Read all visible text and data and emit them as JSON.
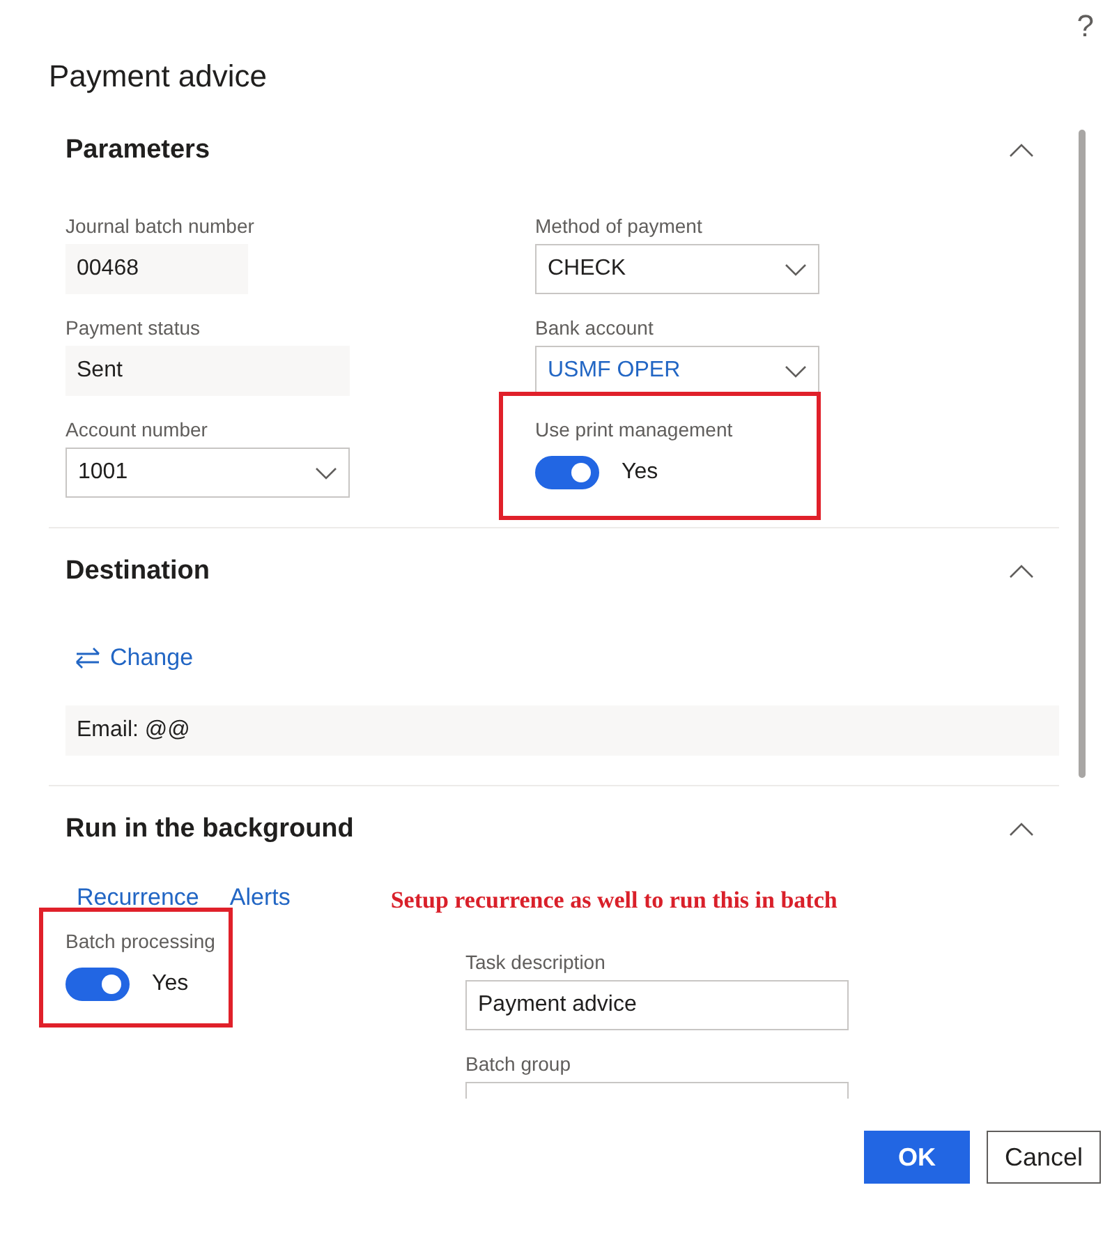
{
  "help": "?",
  "title": "Payment advice",
  "parameters": {
    "title": "Parameters",
    "expanded": true,
    "left_fields": [
      {
        "kind": "readonly",
        "label": "Journal batch number",
        "value": "00468"
      },
      {
        "kind": "readonly",
        "label": "Payment status",
        "value": "Sent"
      },
      {
        "kind": "dropdown",
        "label": "Account number",
        "value": "1001",
        "link": false
      }
    ],
    "right_fields": [
      {
        "kind": "dropdown",
        "label": "Method of payment",
        "value": "CHECK",
        "link": false
      },
      {
        "kind": "dropdown",
        "label": "Bank account",
        "value": "USMF OPER",
        "link": true
      },
      {
        "kind": "toggle",
        "label": "Use print management",
        "on": true,
        "value": "Yes",
        "highlighted": true
      }
    ]
  },
  "destination": {
    "title": "Destination",
    "expanded": true,
    "change_link": "Change",
    "email": "Email: @@"
  },
  "background": {
    "title": "Run in the background",
    "expanded": true,
    "tabs": [
      {
        "label": "Recurrence",
        "selected": false
      },
      {
        "label": "Alerts",
        "selected": false
      }
    ],
    "annotation": "Setup recurrence as well to run this in batch",
    "batch_processing": {
      "kind": "toggle",
      "label": "Batch processing",
      "on": true,
      "value": "Yes",
      "highlighted": true
    },
    "fields": [
      {
        "kind": "text",
        "label": "Task description",
        "value": "Payment advice"
      },
      {
        "kind": "text",
        "label": "Batch group"
      }
    ]
  },
  "buttons": [
    {
      "label": "OK",
      "kind": "primary"
    },
    {
      "label": "Cancel",
      "kind": "secondary"
    }
  ]
}
